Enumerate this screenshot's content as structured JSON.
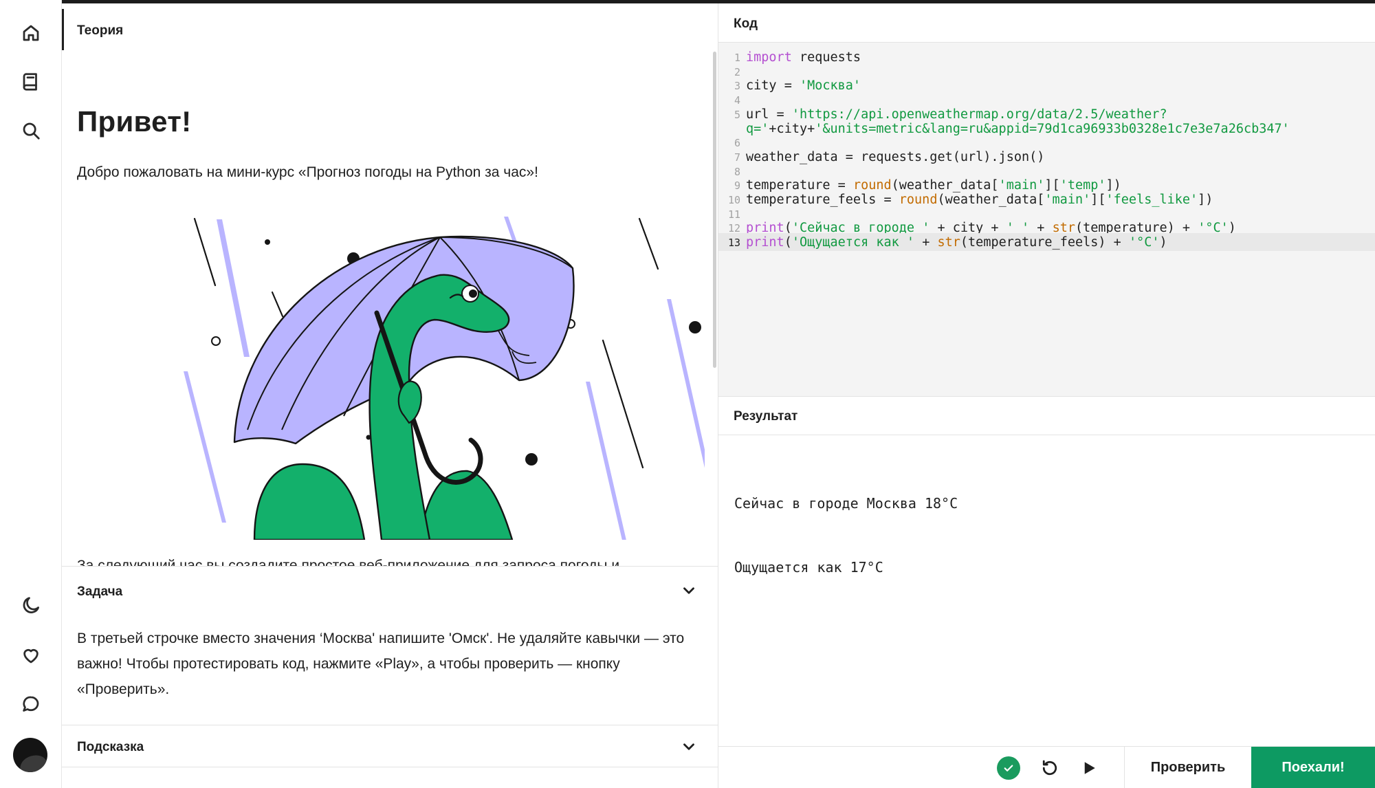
{
  "nav": {
    "icons": [
      "home-icon",
      "book-icon",
      "search-icon",
      "moon-icon",
      "heart-icon",
      "chat-icon"
    ]
  },
  "theory": {
    "tab_label": "Теория",
    "heading": "Привет!",
    "intro": "Добро пожаловать на мини-курс «Прогноз погоды на Python за час»!",
    "illustration": "python-snake-umbrella",
    "next_paragraph": "За следующий час вы создадите простое веб-приложение для запроса погоды и"
  },
  "task": {
    "title": "Задача",
    "text": "В третьей строчке вместо значения ‘Москва' напишите 'Омск'. Не удаляйте кавычки — это важно! Чтобы протестировать код, нажмите «Play», а чтобы проверить  — кнопку «Проверить»."
  },
  "hint": {
    "title": "Подсказка"
  },
  "code": {
    "title": "Код",
    "active_line": 13,
    "lines": [
      {
        "n": "1",
        "text": "import requests"
      },
      {
        "n": "2",
        "text": ""
      },
      {
        "n": "3",
        "text": "city = 'Москва'"
      },
      {
        "n": "4",
        "text": ""
      },
      {
        "n": "5",
        "text": "url = 'https://api.openweathermap.org/data/2.5/weather?"
      },
      {
        "n": "",
        "text": "q='+city+'&units=metric&lang=ru&appid=79d1ca96933b0328e1c7e3e7a26cb347'"
      },
      {
        "n": "6",
        "text": ""
      },
      {
        "n": "7",
        "text": "weather_data = requests.get(url).json()"
      },
      {
        "n": "8",
        "text": ""
      },
      {
        "n": "9",
        "text": "temperature = round(weather_data['main']['temp'])"
      },
      {
        "n": "10",
        "text": "temperature_feels = round(weather_data['main']['feels_like'])"
      },
      {
        "n": "11",
        "text": ""
      },
      {
        "n": "12",
        "text": "print('Сейчас в городе ' + city + ' ' + str(temperature) + '°C')"
      },
      {
        "n": "13",
        "text": "print('Ощущается как ' + str(temperature_feels) + '°C')"
      }
    ]
  },
  "result": {
    "title": "Результат",
    "output": [
      "Сейчас в городе Москва 18°C",
      "Ощущается как 17°C"
    ]
  },
  "toolbar": {
    "status": "success",
    "check_label": "Проверить",
    "go_label": "Поехали!"
  },
  "colors": {
    "accent": "#0d9a62",
    "keyword": "#b44fd1",
    "string": "#119940",
    "builtin": "#c26b00",
    "snake": "#13b06b",
    "umbrella": "#b9b4ff"
  }
}
